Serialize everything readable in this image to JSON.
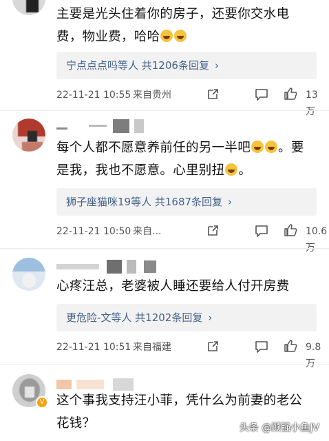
{
  "comments": [
    {
      "text_line1": "主要是光头住着你的房子，还要你交水电",
      "text_line2": "费，物业费，哈哈",
      "replies_label": "宁点点点吗等人 共1206条回复",
      "date": "22-11-21 10:55",
      "location": "来自贵州",
      "likes": "13万"
    },
    {
      "text_line1": "每个人都不愿意养前任的另一半吧",
      "text_line1_after": "。要",
      "text_line2": "是我，我也不愿意。心里别扭",
      "text_line2_after": "。",
      "replies_label": "狮子座猫咪19等人 共1687条回复",
      "date": "22-11-21 10:50",
      "location": "来自...",
      "likes": "10.6万"
    },
    {
      "text_line1": "心疼汪总，老婆被人睡还要给人付开房费",
      "replies_label": "更危险-文等人 共1202条回复",
      "date": "22-11-21 10:51",
      "location": "来自福建",
      "likes": "9.8万"
    },
    {
      "text_line1": "这个事我支持汪小菲，凭什么为前妻的老公",
      "text_line2": "花钱？"
    }
  ],
  "icons": {
    "share": "share-icon",
    "comment": "comment-icon",
    "like": "thumb-up-icon",
    "chevron": "chevron-right-icon",
    "laugh": "laughing-emoji-icon"
  },
  "watermark": "头条 @顾强小鱼JV",
  "colors": {
    "reply_text": "#44628a",
    "reply_bg": "#f2f2f2",
    "meta_text": "#555555",
    "badge": "#f7a10c"
  }
}
